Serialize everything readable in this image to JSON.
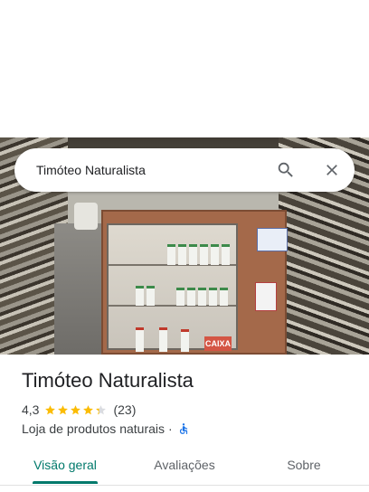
{
  "search": {
    "query": "Timóteo Naturalista"
  },
  "icons": {
    "search": "search-icon",
    "close": "close-icon",
    "accessibility": "wheelchair-accessible-icon"
  },
  "hero_photo": {
    "sign_caixa": "CAIXA"
  },
  "place": {
    "name": "Timóteo Naturalista",
    "rating": "4,3",
    "rating_value": 4.3,
    "stars_max": 5,
    "review_count": "(23)",
    "category": "Loja de produtos naturais",
    "separator": "·"
  },
  "tabs": [
    {
      "label": "Visão geral",
      "active": true
    },
    {
      "label": "Avaliações",
      "active": false
    },
    {
      "label": "Sobre",
      "active": false
    }
  ],
  "colors": {
    "accent": "#00796b",
    "star": "#fbbc04",
    "accessibility": "#1a73e8",
    "text_primary": "#202124",
    "text_secondary": "#5f6368"
  }
}
